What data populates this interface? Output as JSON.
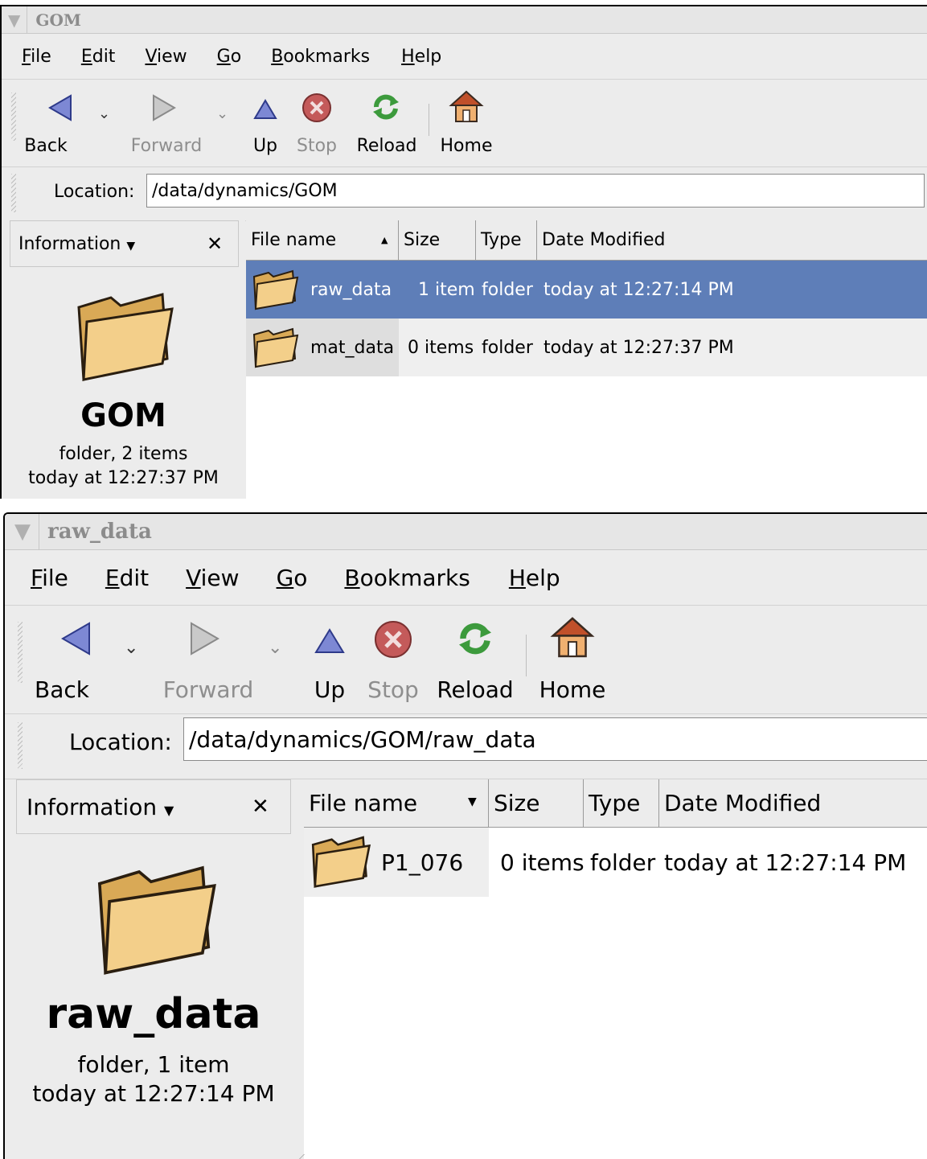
{
  "windows": [
    {
      "title": "GOM",
      "menu": [
        "File",
        "Edit",
        "View",
        "Go",
        "Bookmarks",
        "Help"
      ],
      "menu_mnemonics": [
        "F",
        "E",
        "V",
        "G",
        "B",
        "H"
      ],
      "toolbar": {
        "back": "Back",
        "forward": "Forward",
        "up": "Up",
        "stop": "Stop",
        "reload": "Reload",
        "home": "Home"
      },
      "location_label": "Location:",
      "location_value": "/data/dynamics/GOM",
      "side_panel": {
        "selector": "Information",
        "name": "GOM",
        "info": "folder, 2 items",
        "modified": "today at 12:27:37 PM"
      },
      "columns": [
        "File name",
        "Size",
        "Type",
        "Date Modified"
      ],
      "sort_direction": "ascending",
      "files": [
        {
          "name": "raw_data",
          "size": "1 item",
          "type": "folder",
          "modified": "today at 12:27:14 PM",
          "selected": true
        },
        {
          "name": "mat_data",
          "size": "0 items",
          "type": "folder",
          "modified": "today at 12:27:37 PM",
          "selected": false
        }
      ]
    },
    {
      "title": "raw_data",
      "menu": [
        "File",
        "Edit",
        "View",
        "Go",
        "Bookmarks",
        "Help"
      ],
      "menu_mnemonics": [
        "F",
        "E",
        "V",
        "G",
        "B",
        "H"
      ],
      "toolbar": {
        "back": "Back",
        "forward": "Forward",
        "up": "Up",
        "stop": "Stop",
        "reload": "Reload",
        "home": "Home"
      },
      "location_label": "Location:",
      "location_value": "/data/dynamics/GOM/raw_data",
      "side_panel": {
        "selector": "Information",
        "name": "raw_data",
        "info": "folder, 1 item",
        "modified": "today at 12:27:14 PM"
      },
      "columns": [
        "File name",
        "Size",
        "Type",
        "Date Modified"
      ],
      "sort_direction": "descending",
      "files": [
        {
          "name": "P1_076",
          "size": "0 items",
          "type": "folder",
          "modified": "today at 12:27:14 PM",
          "selected": false
        }
      ]
    }
  ],
  "colors": {
    "selection": "#5e7eb8",
    "folder": "#f0c878",
    "home_roof": "#c0502a"
  }
}
